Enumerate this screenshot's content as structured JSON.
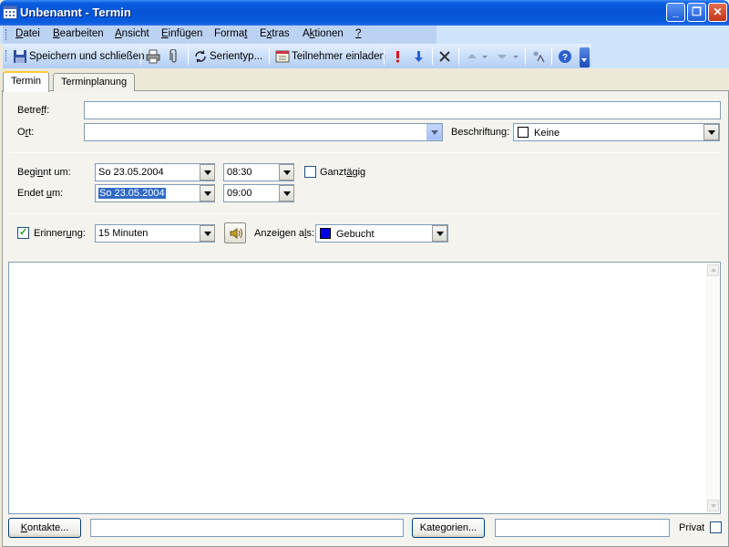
{
  "window": {
    "title": "Unbenannt - Termin",
    "minimize": "_",
    "maximize": "❐",
    "close": "✕"
  },
  "menu": [
    {
      "pre": "",
      "u": "D",
      "post": "atei"
    },
    {
      "pre": "",
      "u": "B",
      "post": "earbeiten"
    },
    {
      "pre": "",
      "u": "A",
      "post": "nsicht"
    },
    {
      "pre": "",
      "u": "E",
      "post": "infügen"
    },
    {
      "pre": "Forma",
      "u": "t",
      "post": ""
    },
    {
      "pre": "E",
      "u": "x",
      "post": "tras"
    },
    {
      "pre": "A",
      "u": "k",
      "post": "tionen"
    },
    {
      "pre": "",
      "u": "?",
      "post": ""
    }
  ],
  "toolbar": {
    "save_close": "Speichern und schließen",
    "recurrence": "Serientyp...",
    "invite": "Teilnehmer einladen"
  },
  "tabs": [
    "Termin",
    "Terminplanung"
  ],
  "form": {
    "subject_label": {
      "pre": "Betre",
      "u": "f",
      "post": "f:"
    },
    "subject_value": "",
    "location_label": {
      "pre": "O",
      "u": "r",
      "post": "t:"
    },
    "location_value": "",
    "label_label": {
      "pre": "Beschriftun",
      "u": "g",
      "post": ":"
    },
    "label_value": "Keine",
    "start_label": {
      "pre": "Begi",
      "u": "n",
      "post": "nt um:"
    },
    "start_date": "So 23.05.2004",
    "start_time": "08:30",
    "end_label": {
      "pre": "Endet ",
      "u": "u",
      "post": "m:"
    },
    "end_date": "So 23.05.2004",
    "end_time": "09:00",
    "allday_label": {
      "pre": "Ganzt",
      "u": "ä",
      "post": "gig"
    },
    "allday_checked": false,
    "reminder_label": {
      "pre": "Erinner",
      "u": "u",
      "post": "ng:"
    },
    "reminder_checked": true,
    "reminder_value": "15 Minuten",
    "showas_label": {
      "pre": "Anzeigen a",
      "u": "l",
      "post": "s:"
    },
    "showas_value": "Gebucht",
    "showas_color": "#0000e0"
  },
  "footer": {
    "contacts_button": {
      "pre": "",
      "u": "K",
      "post": "ontakte..."
    },
    "contacts_value": "",
    "categories_button": {
      "pre": "Kate",
      "u": "g",
      "post": "orien..."
    },
    "categories_value": "",
    "private_label": "Privat"
  }
}
